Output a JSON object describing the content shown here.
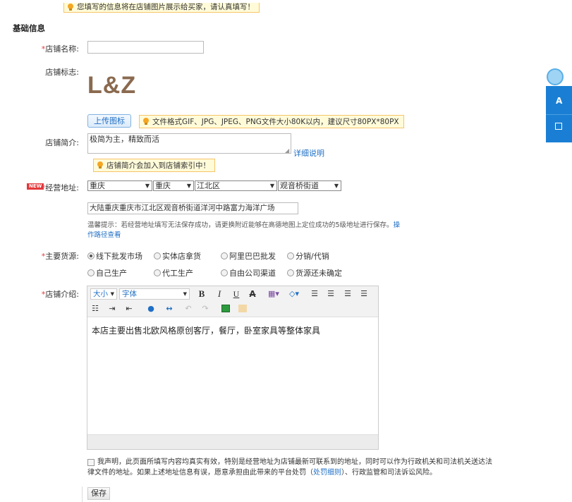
{
  "top_notice": "您填写的信息将在店铺图片展示给买家，请认真填写！",
  "section_title": "基础信息",
  "shop_name": {
    "label": "店铺名称:",
    "required": "*",
    "value": ""
  },
  "shop_logo": {
    "label": "店铺标志:",
    "logo_text": "L&Z",
    "upload_button": "上传图标",
    "upload_tip": "文件格式GIF、JPG、JPEG、PNG文件大小80K以内，建议尺寸80PX*80PX"
  },
  "shop_intro": {
    "label": "店铺简介:",
    "value": "极简为主，精致而活",
    "detail_link": "详细说明",
    "tip": "店铺简介会加入到店铺索引中！"
  },
  "address": {
    "new_badge": "NEW",
    "required": "*",
    "label": "经营地址:",
    "province": "重庆",
    "city": "重庆",
    "district": "江北区",
    "street": "观音桥街道",
    "detail": "大陆重庆重庆市江北区观音桥街道洋河中路富力海洋广场",
    "hint_line1": "温馨提示：若经营地址填写无法保存成功，请更换附近能够在高德地图上定位成功的5级地址进行保存。",
    "hint_link_a": "操",
    "hint_link_b": "作路径查看"
  },
  "source": {
    "required": "*",
    "label": "主要货源:",
    "options": [
      "线下批发市场",
      "实体店拿货",
      "阿里巴巴批发",
      "分销/代销",
      "自己生产",
      "代工生产",
      "自由公司渠道",
      "货源还未确定"
    ],
    "selected": "线下批发市场"
  },
  "description": {
    "required": "*",
    "label": "店铺介绍:",
    "toolbar": {
      "size": "大小",
      "font": "字体",
      "bold": "B",
      "italic": "I",
      "underline": "U",
      "strike": "A"
    },
    "content": "本店主要出售北欧风格原创客厅，餐厅，卧室家具等整体家具"
  },
  "declaration": {
    "line1": "我声明，此页面所填写内容均真实有效，特别是经营地址为店铺最新可联系到的地址，同时可以作为行政机关和司法机关送达法",
    "line2_a": "律文件的地址。如果上述地址信息有误，愿意承担由此带来的平台处罚（",
    "line2_link": "处罚细则",
    "line2_b": "）、行政监管和司法诉讼风险。"
  },
  "save_button": "保存",
  "colors": {
    "accent_link": "#1f6fc5",
    "required": "#e4393c",
    "tip_bg": "#fffbd9",
    "tip_border": "#f6c469",
    "logo": "#8a6a4f",
    "sidebar_blue": "#1a7fd4"
  }
}
